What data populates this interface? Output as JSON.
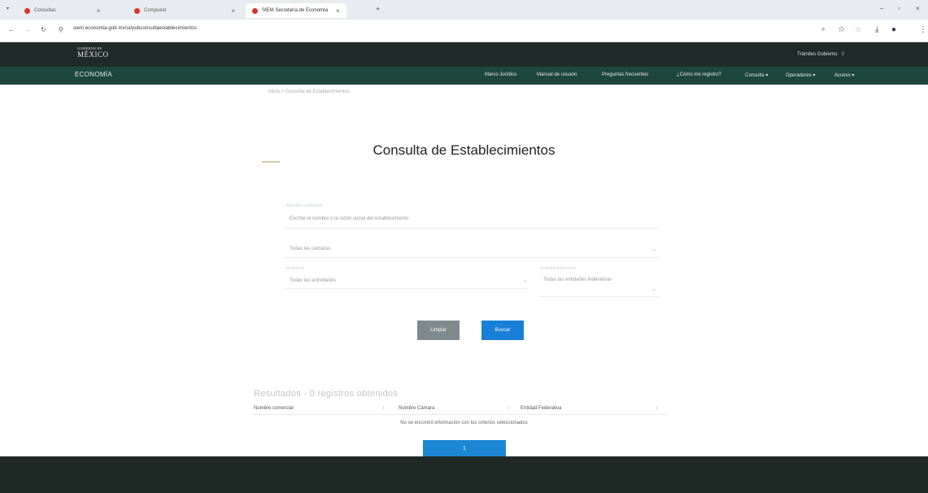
{
  "browser": {
    "tabs": [
      {
        "label": "Consultas",
        "active": false
      },
      {
        "label": "Compuest",
        "active": false
      },
      {
        "label": "SIEM Secretaría de Economía",
        "active": true
      }
    ],
    "new_tab": "+",
    "window_controls": [
      "–",
      "▫",
      "×"
    ],
    "url": "siem.economia.gob.mx/ui/pubconsultaestablecimientos",
    "toolbar_icons": [
      "search-icon",
      "star-icon",
      "extensions-icon",
      "download-icon",
      "profile-icon",
      "menu-icon"
    ]
  },
  "gov_header": {
    "logo_small": "GOBIERNO DE",
    "logo_big": "MÉXICO",
    "links": "Trámites  Gobierno"
  },
  "eco_header": {
    "title": "ECONOMÍA",
    "menu": [
      "Marco Jurídico",
      "Manual de usuario",
      "Preguntas frecuentes",
      "¿Cómo me registro?",
      "Consulta ▾",
      "Operadores ▾",
      "Acceso ▾"
    ]
  },
  "breadcrumb": "Inicio > Consulta de Establecimientos",
  "page_title": "Consulta de Establecimientos",
  "form": {
    "name_label": "Nombre comercial",
    "name_placeholder": "Escribe el nombre o la razón social del establecimiento",
    "camara_value": "Todas las cámaras",
    "actividad_label": "Actividad",
    "actividad_value": "Todas las actividades",
    "entidad_label": "Entidad federativa",
    "entidad_value": "Todas las entidades federativas",
    "clear_label": "Limpiar",
    "search_label": "Buscar"
  },
  "results": {
    "title": "Resultados - 0 registros obtenidos",
    "columns": [
      "Nombre comercial",
      "Nombre Cámara",
      "Entidad Federativa"
    ],
    "empty_message": "No se encontró información con los criterios seleccionados",
    "page": "1"
  },
  "colors": {
    "gov_header": "#1f2b28",
    "eco_header": "#1e463d",
    "primary_button": "#1880d8",
    "secondary_button": "#7f8a8e",
    "footer": "#1f2a26"
  }
}
